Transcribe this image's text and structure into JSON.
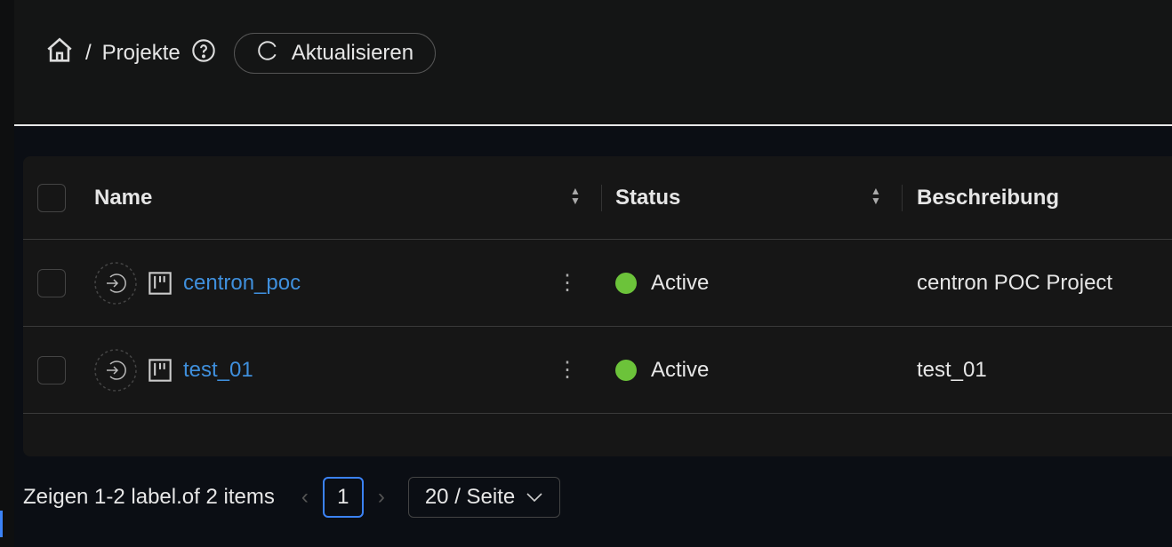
{
  "breadcrumb": {
    "separator": "/",
    "current": "Projekte"
  },
  "toolbar": {
    "refresh_label": "Aktualisieren"
  },
  "table": {
    "columns": [
      "Name",
      "Status",
      "Beschreibung"
    ],
    "rows": [
      {
        "name": "centron_poc",
        "status": "Active",
        "description": "centron POC Project"
      },
      {
        "name": "test_01",
        "status": "Active",
        "description": "test_01"
      }
    ]
  },
  "pagination": {
    "summary": "Zeigen 1-2 label.of 2 items",
    "current_page": "1",
    "page_size": "20 / Seite"
  },
  "colors": {
    "accent": "#3b82f6",
    "active": "#6cc33a",
    "link": "#3f8fdc"
  }
}
